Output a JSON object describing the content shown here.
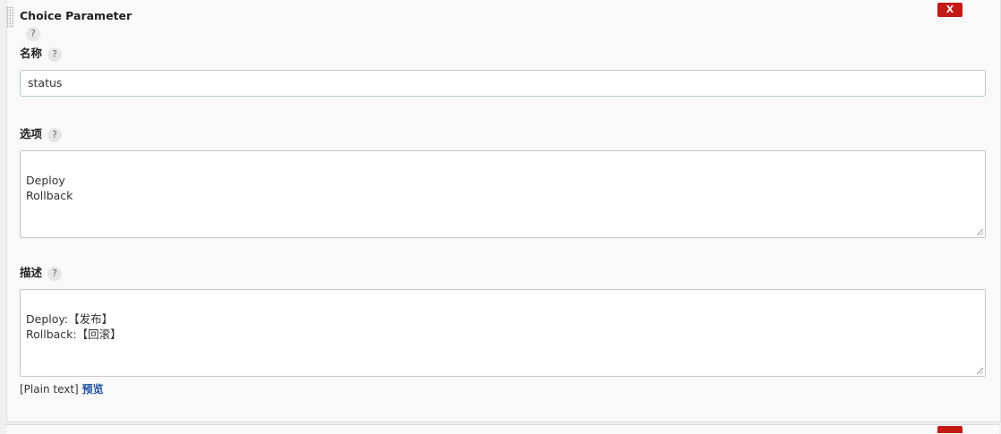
{
  "panel": {
    "title": "Choice Parameter",
    "help_glyph": "?",
    "close_label": "X",
    "close_color": "#c41a16"
  },
  "name_field": {
    "label": "名称",
    "value": "status"
  },
  "choices_field": {
    "label": "选项",
    "value": "Deploy\nRollback"
  },
  "description_field": {
    "label": "描述",
    "value": "Deploy:【发布】\nRollback:【回滚】"
  },
  "description_footer": {
    "plain_text": "[Plain text]",
    "preview_link": "预览",
    "link_color": "#1c4e9e"
  }
}
